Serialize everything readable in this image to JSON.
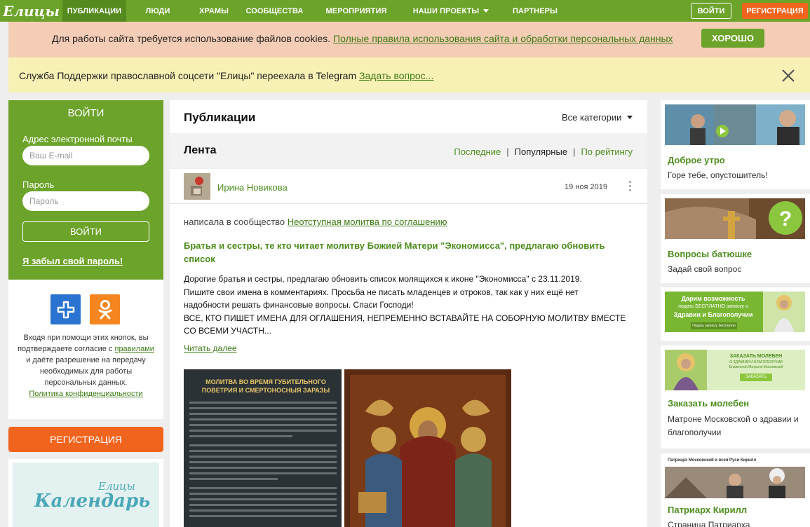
{
  "nav": {
    "logo": "Елицы",
    "items": [
      "Публикации",
      "Люди",
      "Храмы",
      "Сообщества",
      "Мероприятия",
      "Наши проекты",
      "Партнеры"
    ],
    "login": "Войти",
    "register": "Регистрация"
  },
  "cookie": {
    "text": "Для работы сайта требуется использование файлов cookies.",
    "link": "Полные правила использования сайта и обработки персональных данных",
    "ok": "ХОРОШО"
  },
  "telegram": {
    "text": "Служба Поддержки православной соцсети \"Елицы\" переехала в Telegram",
    "link": "Задать вопрос..."
  },
  "login": {
    "title": "ВОЙТИ",
    "email_label": "Адрес электронной почты",
    "email_placeholder": "Ваш E-mail",
    "password_label": "Пароль",
    "password_placeholder": "Пароль",
    "submit": "ВОЙТИ",
    "forgot": "Я забыл свой пароль!"
  },
  "social": {
    "text1": "Входя при помощи этих кнопок, вы подтверждаете согласие",
    "text2_pre": "с",
    "rules_link": "правилами",
    "text2_post": "и даёте разрешение на передачу необходимых для работы персональных данных.",
    "privacy_link": "Политика конфиденциальности"
  },
  "register_left": "РЕГИСТРАЦИЯ",
  "calendar": {
    "small": "Елицы",
    "big": "Календарь"
  },
  "publications": {
    "title": "Публикации",
    "categories": "Все категории"
  },
  "feed": {
    "title": "Лента",
    "sort": [
      "Последние",
      "Популярные",
      "По рейтингу"
    ],
    "active_sort": "Популярные"
  },
  "post": {
    "author": "Ирина Новикова",
    "date": "19 ноя 2019",
    "wrote": "написала в сообщество",
    "community": "Неотступная молитва по соглашению",
    "title": "Братья и сестры, те кто читает молитву Божией Матери \"Экономисса\", предлагаю обновить список",
    "body": [
      "Дорогие братья и сестры, предлагаю обновить список молящихся к иконе \"Экономисса\" с 23.11.2019.",
      "Пишите свои имена в комментариях. Просьба не писать младенцев и отроков, так как у них ещё нет",
      "надобности решать финансовые вопросы. Спаси Господи!",
      "ВСЕ, КТО ПИШЕТ ИМЕНА ДЛЯ ОГЛАШЕНИЯ, НЕПРЕМЕННО ВСТАВАЙТЕ НА СОБОРНУЮ МОЛИТВУ ВМЕСТЕ",
      "СО ВСЕМИ УЧАСТН..."
    ],
    "read_more": "Читать далее",
    "image_title": "Молитва во время губительного поветрия и смертоносныя заразы"
  },
  "right": [
    {
      "title": "Доброе утро",
      "subtitle": "Горе тебе, опустошитель!"
    },
    {
      "title": "Вопросы батюшке",
      "subtitle": "Задай свой вопрос"
    },
    {
      "banner_line1": "Дарим возможность",
      "banner_line2": "подать БЕСПЛАТНО записку о",
      "banner_line3": "Здравии и Благополучии",
      "banner_btn": "Подать записку бесплатно"
    },
    {
      "banner_line1": "ЗАКАЗАТЬ МОЛЕБЕН",
      "banner_line2": "О ЗДРАВИИ И БЛАГОПОЛУЧИИ",
      "banner_line3": "Блаженной Матроне Московской",
      "banner_btn": "ЗАКАЗАТЬ",
      "title": "Заказать молебен",
      "subtitle": "Матроне Московской о здравии и благополучии"
    },
    {
      "banner_line1": "Патриарх Московский и всея Руси Кирилл",
      "title": "Патриарх Кирилл",
      "subtitle": "Страница Патриарха"
    }
  ]
}
